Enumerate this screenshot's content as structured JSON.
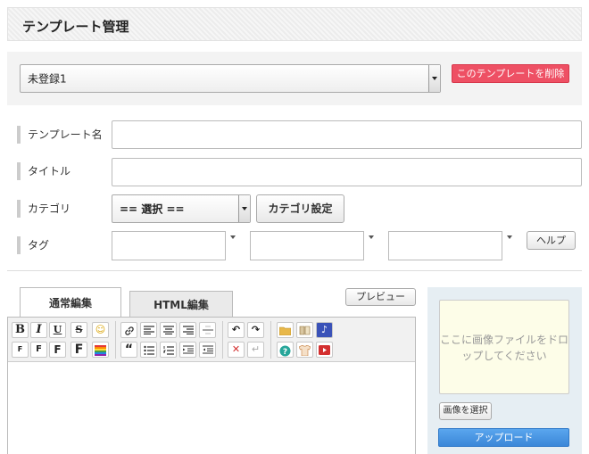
{
  "header": {
    "title": "テンプレート管理"
  },
  "template_panel": {
    "selected": "未登録1",
    "delete_label": "このテンプレートを削除"
  },
  "form": {
    "name_label": "テンプレート名",
    "title_label": "タイトル",
    "category_label": "カテゴリ",
    "category_selected": "== 選択 ==",
    "category_settings_label": "カテゴリ設定",
    "tag_label": "タグ",
    "help_label": "ヘルプ"
  },
  "editor": {
    "tabs": [
      "通常編集",
      "HTML編集"
    ],
    "preview_label": "プレビュー",
    "toolbar_row1": [
      {
        "name": "bold-button",
        "glyph": "B"
      },
      {
        "name": "italic-button",
        "glyph": "I"
      },
      {
        "name": "underline-button",
        "glyph": "U"
      },
      {
        "name": "strikethrough-button",
        "glyph": "S"
      },
      {
        "name": "emoji-button",
        "glyph": "☺"
      },
      {
        "name": "link-button",
        "glyph": "🔗"
      },
      {
        "name": "align-left-button",
        "glyph": "≡"
      },
      {
        "name": "align-center-button",
        "glyph": "≡"
      },
      {
        "name": "align-right-button",
        "glyph": "≡"
      },
      {
        "name": "horizontal-rule-button",
        "glyph": "—"
      },
      {
        "name": "undo-button",
        "glyph": "↶"
      },
      {
        "name": "redo-button",
        "glyph": "↷"
      },
      {
        "name": "folder-button",
        "glyph": "📁"
      },
      {
        "name": "book-button",
        "glyph": "📖"
      },
      {
        "name": "music-button",
        "glyph": "♪"
      }
    ],
    "toolbar_row2": [
      {
        "name": "font-size-xs-button",
        "glyph": "F"
      },
      {
        "name": "font-size-s-button",
        "glyph": "F"
      },
      {
        "name": "font-size-m-button",
        "glyph": "F"
      },
      {
        "name": "font-size-l-button",
        "glyph": "F"
      },
      {
        "name": "text-color-button",
        "glyph": ""
      },
      {
        "name": "blockquote-button",
        "glyph": "“"
      },
      {
        "name": "bullet-list-button",
        "glyph": "•"
      },
      {
        "name": "numbered-list-button",
        "glyph": "1"
      },
      {
        "name": "indent-button",
        "glyph": "→"
      },
      {
        "name": "outdent-button",
        "glyph": "←"
      },
      {
        "name": "remove-format-button",
        "glyph": "✕"
      },
      {
        "name": "line-break-button",
        "glyph": "↵"
      },
      {
        "name": "help-circle-button",
        "glyph": "?"
      },
      {
        "name": "shirt-button",
        "glyph": "👕"
      },
      {
        "name": "youtube-button",
        "glyph": "▶"
      }
    ]
  },
  "uploader": {
    "drop_text": "ここに画像ファイルをドロップしてください",
    "select_label": "画像を選択",
    "upload_label": "アップロード"
  },
  "colors": {
    "accent_red": "#ee5064",
    "accent_blue": "#3b87d8"
  }
}
